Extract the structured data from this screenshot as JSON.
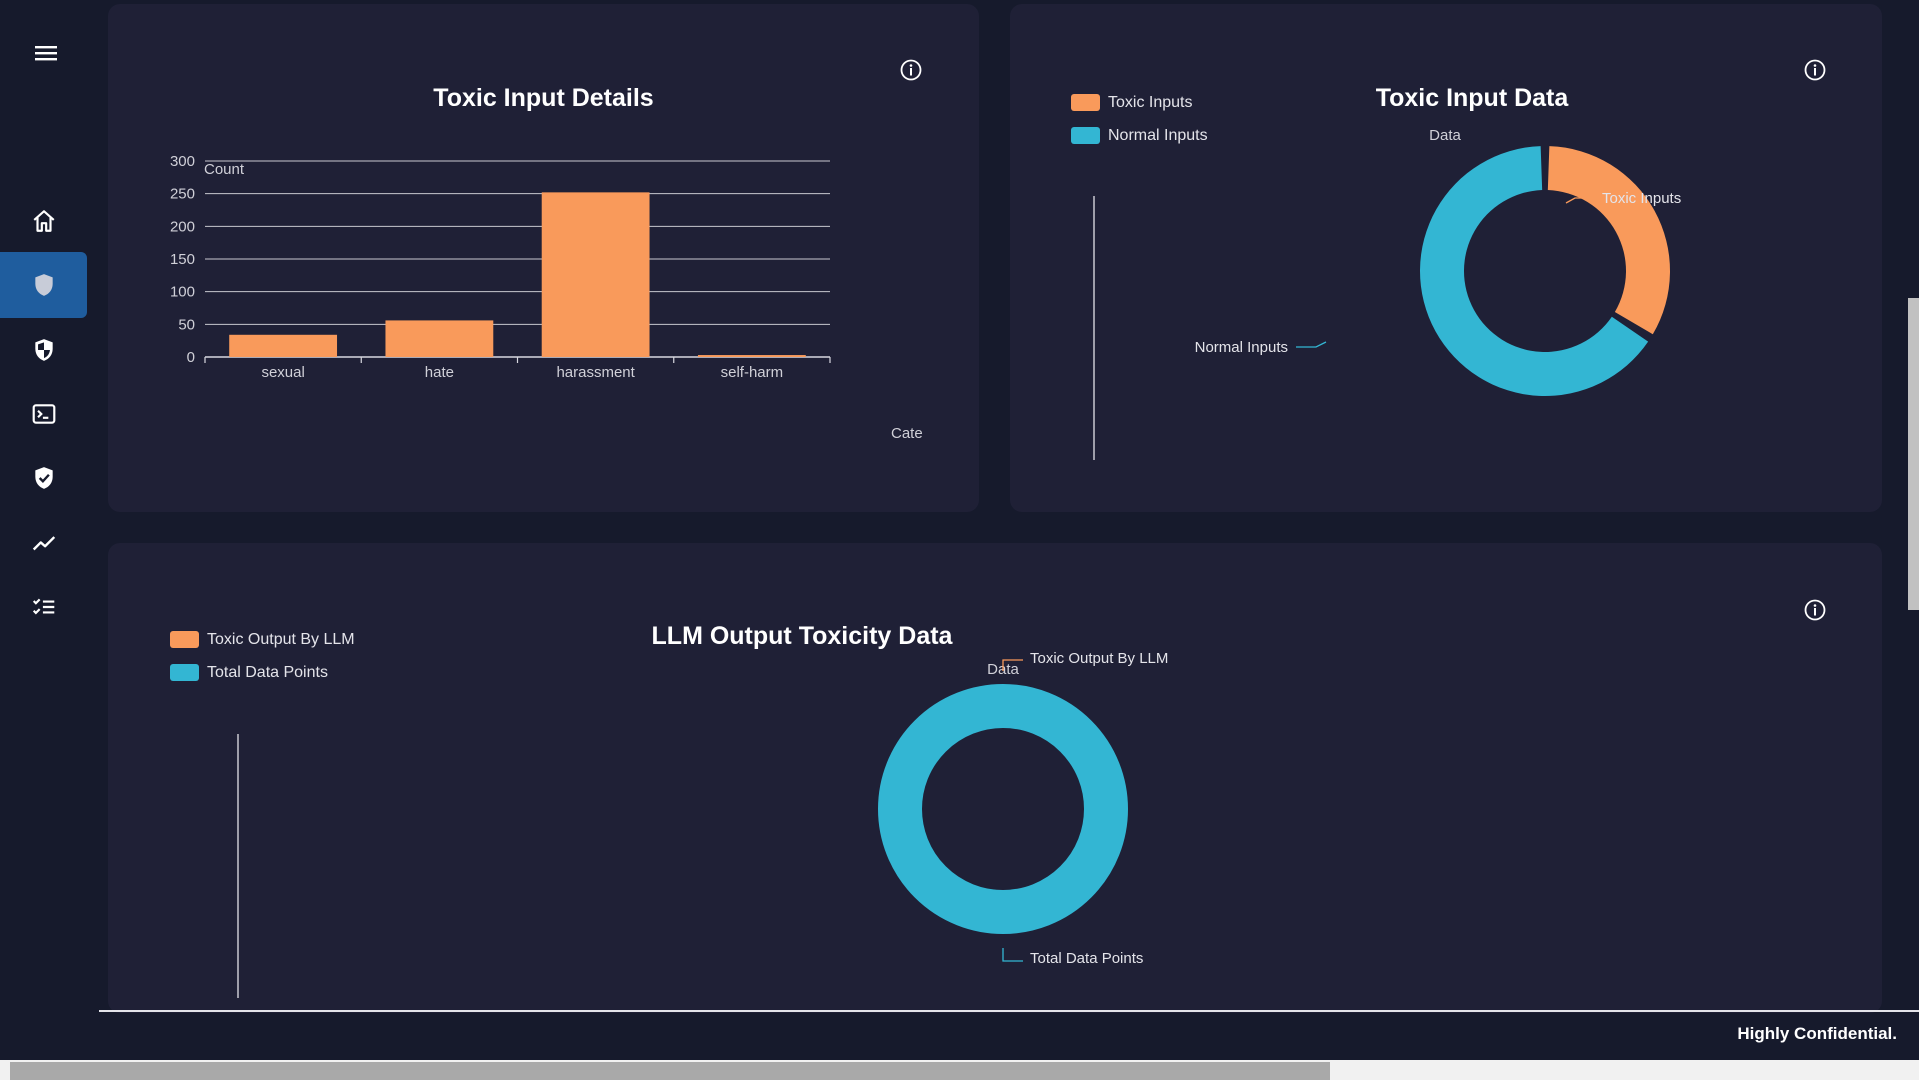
{
  "sidebar": {
    "items": [
      {
        "icon": "home-icon"
      },
      {
        "icon": "shield-icon",
        "active": true
      },
      {
        "icon": "shield-half-icon"
      },
      {
        "icon": "terminal-icon"
      },
      {
        "icon": "shield-check-icon"
      },
      {
        "icon": "trend-line-icon"
      },
      {
        "icon": "checklist-icon"
      }
    ]
  },
  "colors": {
    "orange": "#f99a5b",
    "cyan": "#33b6d3",
    "card": "#1f2036",
    "background": "#161a2c",
    "active_nav": "#1f5d9e"
  },
  "toxic_input_details": {
    "title": "Toxic Input Details",
    "chart_data": {
      "type": "bar",
      "title": "Toxic Input Details",
      "ylabel": "Count",
      "xlabel": "Cate",
      "categories": [
        "sexual",
        "hate",
        "harassment",
        "self-harm"
      ],
      "values": [
        34,
        56,
        252,
        3
      ],
      "ylim": [
        0,
        300
      ],
      "yticks": [
        "0",
        "50",
        "100",
        "150",
        "200",
        "250",
        "300"
      ],
      "grid": true,
      "color": "#f99a5b"
    }
  },
  "toxic_input_data": {
    "title": "Toxic Input Data",
    "legend": [
      "Toxic Inputs",
      "Normal Inputs"
    ],
    "chart_data": {
      "type": "pie",
      "series_name": "Data",
      "labels": [
        "Toxic Inputs",
        "Normal Inputs"
      ],
      "values": [
        34,
        66
      ],
      "colors": [
        "#f99a5b",
        "#33b6d3"
      ]
    }
  },
  "llm_output_toxicity": {
    "title": "LLM Output Toxicity Data",
    "legend": [
      "Toxic Output By LLM",
      "Total Data Points"
    ],
    "chart_data": {
      "type": "pie",
      "series_name": "Data",
      "labels": [
        "Toxic Output By LLM",
        "Total Data Points"
      ],
      "values": [
        0,
        100
      ],
      "colors": [
        "#f99a5b",
        "#33b6d3"
      ]
    }
  },
  "footer": {
    "text": "Highly Confidential."
  }
}
